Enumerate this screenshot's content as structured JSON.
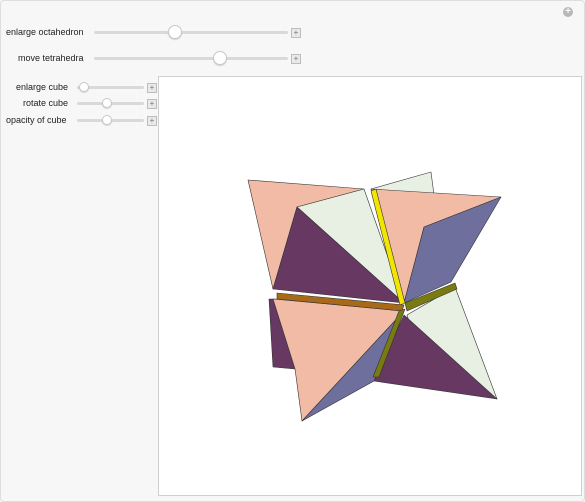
{
  "controls": {
    "enlarge_octahedron": {
      "label": "enlarge octahedron",
      "value": 0.42
    },
    "move_tetrahedra": {
      "label": "move tetrahedra",
      "value": 0.65
    },
    "enlarge_cube": {
      "label": "enlarge cube",
      "value": 0.1
    },
    "rotate_cube": {
      "label": "rotate cube",
      "value": 0.45
    },
    "opacity_of_cube": {
      "label": "opacity of cube",
      "value": 0.45
    }
  },
  "icons": {
    "add": "+",
    "corner": "+"
  },
  "colors": {
    "salmon": "#f2bba6",
    "light_green": "#e7f0e2",
    "dark_purple": "#673862",
    "slate_purple": "#6f6f9e",
    "yellow": "#f2e600",
    "olive": "#7a7a12",
    "brown": "#a86a1a"
  }
}
